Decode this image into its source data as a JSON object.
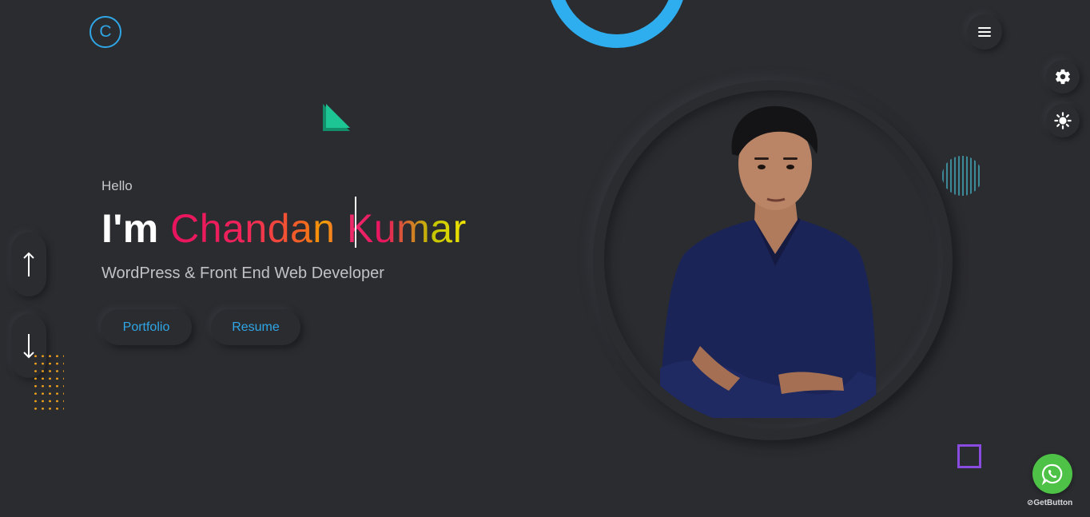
{
  "header": {
    "logo_letter": "C",
    "menu_icon": "hamburger-icon"
  },
  "side_controls": {
    "settings_icon": "gear-icon",
    "theme_icon": "sun-icon"
  },
  "hero": {
    "greeting": "Hello",
    "intro": "I'm",
    "name": "Chandan Kumar",
    "role": "WordPress & Front End Web Developer",
    "buttons": {
      "portfolio": "Portfolio",
      "resume": "Resume"
    }
  },
  "scroll": {
    "up_icon": "arrow-up-icon",
    "down_icon": "arrow-down-icon"
  },
  "widget": {
    "whatsapp_icon": "whatsapp-icon",
    "brand": "GetButton"
  },
  "colors": {
    "background": "#2b2c30",
    "accent": "#2fa6e6",
    "whatsapp": "#4dc247",
    "dots": "#f2a21b",
    "square": "#8a4be0"
  }
}
